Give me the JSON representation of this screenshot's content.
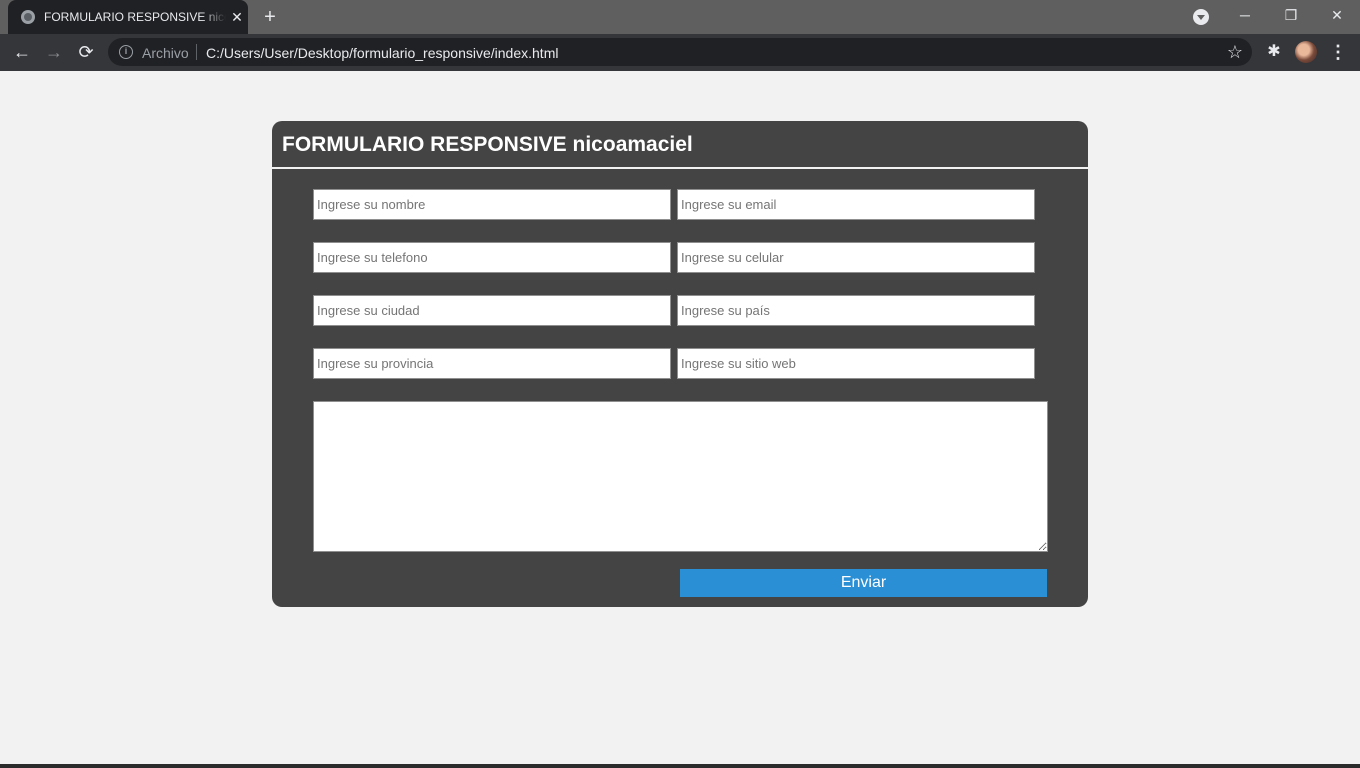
{
  "browser": {
    "tab_title": "FORMULARIO RESPONSIVE nicoamaciel",
    "tab_close_glyph": "✕",
    "new_tab_glyph": "+",
    "window_controls": {
      "minimize": "─",
      "restore": "❐",
      "close": "✕"
    },
    "nav": {
      "back_glyph": "←",
      "forward_glyph": "→",
      "reload_glyph": "⟳"
    },
    "security_label": "Archivo",
    "url": "C:/Users/User/Desktop/formulario_responsive/index.html",
    "icons": {
      "favicon": "globe-icon",
      "tab_search": "tab-search-icon",
      "info": "info-icon",
      "bookmark": "star-icon",
      "extensions": "puzzle-icon",
      "profile": "avatar",
      "menu": "kebab-menu-icon"
    },
    "info_glyph": "i",
    "star_glyph": "☆",
    "extensions_glyph": "✱",
    "menu_glyph": "⋮"
  },
  "form": {
    "title": "FORMULARIO RESPONSIVE nicoamaciel",
    "fields": {
      "nombre": {
        "placeholder": "Ingrese su nombre",
        "value": ""
      },
      "email": {
        "placeholder": "Ingrese su email",
        "value": ""
      },
      "telefono": {
        "placeholder": "Ingrese su telefono",
        "value": ""
      },
      "celular": {
        "placeholder": "Ingrese su celular",
        "value": ""
      },
      "ciudad": {
        "placeholder": "Ingrese su ciudad",
        "value": ""
      },
      "pais": {
        "placeholder": "Ingrese su país",
        "value": ""
      },
      "provincia": {
        "placeholder": "Ingrese su provincia",
        "value": ""
      },
      "sitio_web": {
        "placeholder": "Ingrese su sitio web",
        "value": ""
      }
    },
    "message": {
      "value": ""
    },
    "submit_label": "Enviar"
  },
  "colors": {
    "page_background": "#f2f2f2",
    "card_background": "#444444",
    "submit_background": "#2a8fd4",
    "title_text": "#ffffff"
  }
}
